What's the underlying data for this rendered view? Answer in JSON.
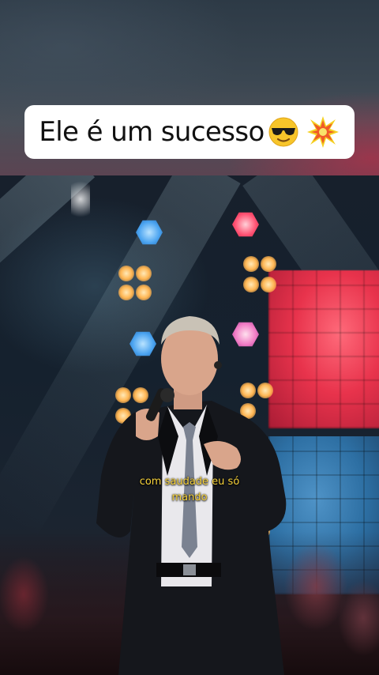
{
  "caption": {
    "text": "Ele é um sucesso",
    "emojis": [
      "smiling-face-with-sunglasses-icon",
      "collision-icon"
    ]
  },
  "video": {
    "subtitle_line1": "com saudade eu só",
    "subtitle_line2": "mando"
  },
  "colors": {
    "subtitle": "#f7d23a",
    "caption_bg": "#ffffff",
    "caption_text": "#111111",
    "led_red": "#e8334c",
    "led_blue": "#2d6fa3"
  }
}
